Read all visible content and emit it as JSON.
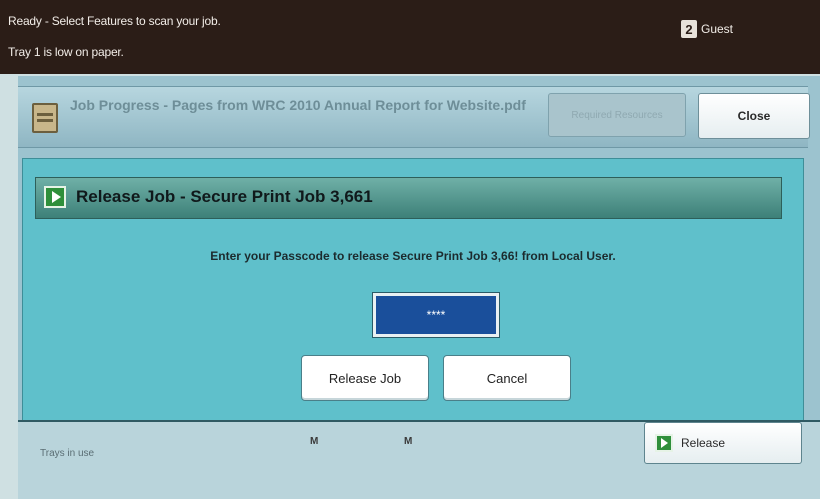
{
  "status": {
    "line1": "Ready -  Select Features to scan your job.",
    "line2": "Tray 1 is low on paper.",
    "user": "Guest",
    "user_icon_glyph": "2"
  },
  "job": {
    "title": "Job Progress - Pages from WRC 2010 Annual Report for Website.pdf",
    "required_resources_label": "Required Resources",
    "close_label": "Close"
  },
  "dialog": {
    "title": "Release Job - Secure Print Job 3,661",
    "prompt": "Enter your Passcode to release Secure Print Job 3,66! from Local User.",
    "passcode_value": "****",
    "release_job_label": "Release Job",
    "cancel_label": "Cancel"
  },
  "bottom": {
    "trays_label": "Trays in use",
    "tray_marks": [
      "M",
      "M"
    ],
    "release_label": "Release"
  },
  "icons": {
    "user": "user-icon",
    "document": "document-icon",
    "play": "play-icon"
  }
}
